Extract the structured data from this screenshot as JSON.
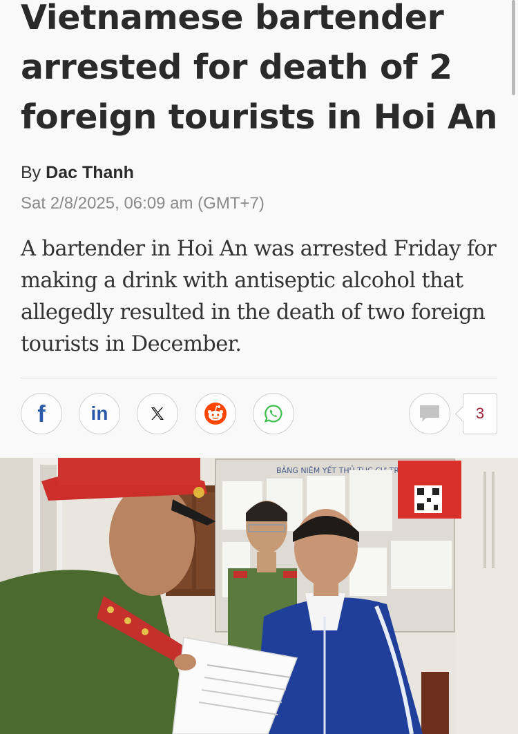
{
  "article": {
    "headline": "Vietnamese bartender arrested for death of 2 foreign tourists in Hoi An",
    "byline_prefix": "By",
    "author": "Dac Thanh",
    "timestamp": "Sat 2/8/2025, 06:09 am (GMT+7)",
    "lead": "A bartender in Hoi An was arrested Friday for making a drink with antiseptic alcohol that allegedly resulted in the death of two foreign tourists in December."
  },
  "share": {
    "buttons": [
      {
        "name": "facebook",
        "icon": "facebook-icon"
      },
      {
        "name": "linkedin",
        "icon": "linkedin-icon"
      },
      {
        "name": "x",
        "icon": "x-icon"
      },
      {
        "name": "reddit",
        "icon": "reddit-icon"
      },
      {
        "name": "whatsapp",
        "icon": "whatsapp-icon"
      }
    ],
    "comments": {
      "icon": "comment-icon",
      "count": "3"
    }
  },
  "photo": {
    "board_heading": "BẢNG NIÊM YẾT THỦ TỤC CƯ TRÚ"
  },
  "colors": {
    "brand_blue": "#2b5aa8",
    "reddit_orange": "#ff4500",
    "whatsapp_green": "#3fbf4f",
    "comment_count": "#9b2335"
  }
}
